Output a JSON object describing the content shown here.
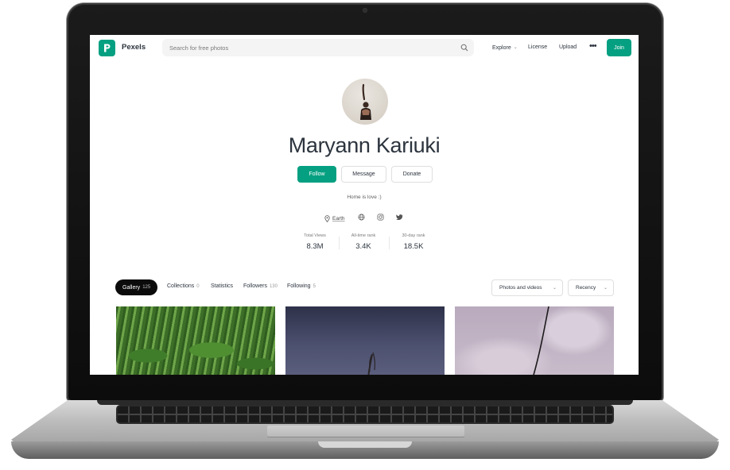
{
  "app": {
    "brand": "Pexels",
    "search_placeholder": "Search for free photos",
    "nav": {
      "explore": "Explore",
      "license": "License",
      "upload": "Upload",
      "more": "•••",
      "join": "Join"
    }
  },
  "profile": {
    "name": "Maryann Kariuki",
    "bio": "Home is love :)",
    "location": "Earth",
    "actions": {
      "follow": "Follow",
      "message": "Message",
      "donate": "Donate"
    },
    "stats": [
      {
        "label": "Total Views",
        "value": "8.3M"
      },
      {
        "label": "All-time rank",
        "value": "3.4K"
      },
      {
        "label": "30-day rank",
        "value": "18.5K"
      }
    ]
  },
  "tabs": [
    {
      "label": "Gallery",
      "count": "125"
    },
    {
      "label": "Collections",
      "count": "0"
    },
    {
      "label": "Statistics",
      "count": ""
    },
    {
      "label": "Followers",
      "count": "130"
    },
    {
      "label": "Following",
      "count": "5"
    }
  ],
  "filters": {
    "media": "Photos and videos",
    "sort": "Recency"
  },
  "icons": {
    "location": "location-pin-icon",
    "website": "globe-icon",
    "instagram": "instagram-icon",
    "twitter": "twitter-icon"
  },
  "colors": {
    "accent": "#05a081",
    "text": "#2c343e",
    "active_tab": "#0b0b0b"
  }
}
